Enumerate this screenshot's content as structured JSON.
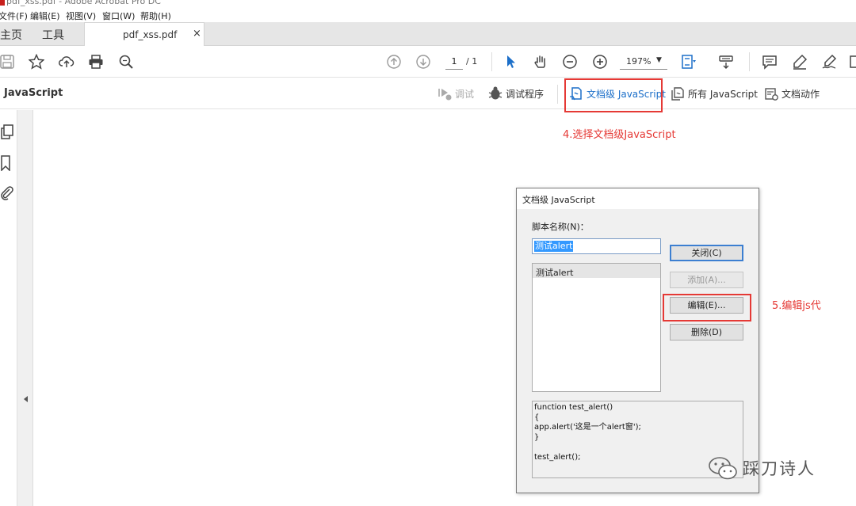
{
  "window": {
    "title": "pdf_xss.pdf - Adobe Acrobat Pro DC"
  },
  "menu": [
    "文件(F)",
    "编辑(E)",
    "视图(V)",
    "窗口(W)",
    "帮助(H)"
  ],
  "tabs": {
    "home": "主页",
    "tools": "工具",
    "document": "pdf_xss.pdf",
    "close": "×"
  },
  "toolbar": {
    "page_current": "1",
    "page_total": "/ 1",
    "zoom": "197%",
    "zoom_caret": "▼"
  },
  "js_toolbar": {
    "title": "JavaScript",
    "debug": "调试",
    "debugger": "调试程序",
    "doc_level": "文档级 JavaScript",
    "all_js": "所有 JavaScript",
    "doc_actions": "文档动作"
  },
  "annotations": {
    "step4": "4.选择文档级JavaScript",
    "step5": "5.编辑js代"
  },
  "dialog": {
    "title": "文档级 JavaScript",
    "script_name_label": "脚本名称(N)：",
    "script_name_value": "测试alert",
    "list_items": [
      "测试alert"
    ],
    "buttons": {
      "close": "关闭(C)",
      "add": "添加(A)...",
      "edit": "编辑(E)...",
      "delete": "删除(D)"
    },
    "code": "function test_alert()\n{\napp.alert('这是一个alert窗');\n}\n\ntest_alert();"
  },
  "watermark": {
    "text": "踩刀诗人",
    "icon": "wechat-icon"
  },
  "colors": {
    "annotation_red": "#e53935",
    "active_blue": "#1c6fc9",
    "selection_blue": "#3399ff"
  }
}
